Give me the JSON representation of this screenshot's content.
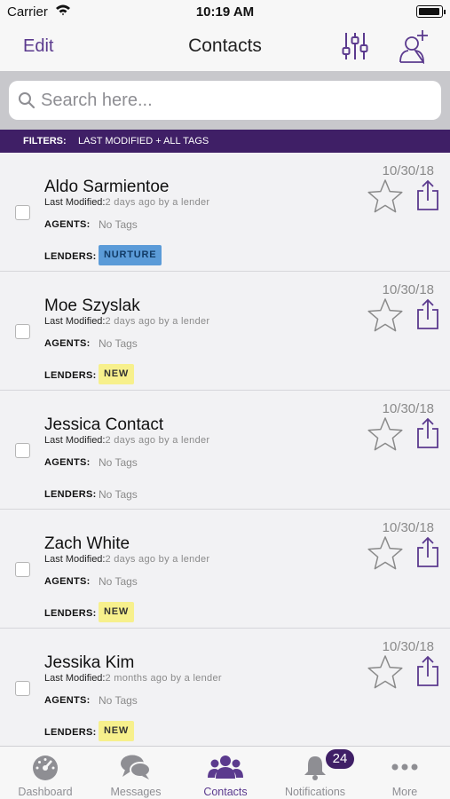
{
  "status_bar": {
    "carrier": "Carrier",
    "time": "10:19 AM"
  },
  "nav": {
    "edit_label": "Edit",
    "title": "Contacts"
  },
  "search": {
    "placeholder": "Search here..."
  },
  "filters": {
    "label": "FILTERS:",
    "value": "LAST MODIFIED + ALL TAGS"
  },
  "labels": {
    "last_modified": "Last Modified:",
    "agents": "AGENTS:",
    "lenders": "LENDERS:"
  },
  "contacts": [
    {
      "name": "Aldo Sarmientoe",
      "modified": "2 days ago by a lender",
      "date": "10/30/18",
      "agents": "No Tags",
      "lenders_tag": "NURTURE",
      "lenders_text": ""
    },
    {
      "name": "Moe Szyslak",
      "modified": "2 days ago by a lender",
      "date": "10/30/18",
      "agents": "No Tags",
      "lenders_tag": "NEW",
      "lenders_text": ""
    },
    {
      "name": "Jessica Contact",
      "modified": "2 days ago by a lender",
      "date": "10/30/18",
      "agents": "No Tags",
      "lenders_tag": "",
      "lenders_text": "No Tags"
    },
    {
      "name": "Zach White",
      "modified": "2 days ago by a lender",
      "date": "10/30/18",
      "agents": "No Tags",
      "lenders_tag": "NEW",
      "lenders_text": ""
    },
    {
      "name": "Jessika Kim",
      "modified": "2 months ago by a lender",
      "date": "10/30/18",
      "agents": "No Tags",
      "lenders_tag": "NEW",
      "lenders_text": ""
    }
  ],
  "tabs": [
    {
      "label": "Dashboard",
      "icon": "gauge-icon"
    },
    {
      "label": "Messages",
      "icon": "chat-bubbles-icon"
    },
    {
      "label": "Contacts",
      "icon": "people-icon"
    },
    {
      "label": "Notifications",
      "icon": "bell-icon"
    },
    {
      "label": "More",
      "icon": "ellipsis-icon"
    }
  ],
  "notifications_badge": "24",
  "colors": {
    "accent": "#5b3a8e",
    "filter_bar": "#3f1f66",
    "nurture_tag": "#5b9bd8",
    "new_tag": "#f7f08c"
  }
}
